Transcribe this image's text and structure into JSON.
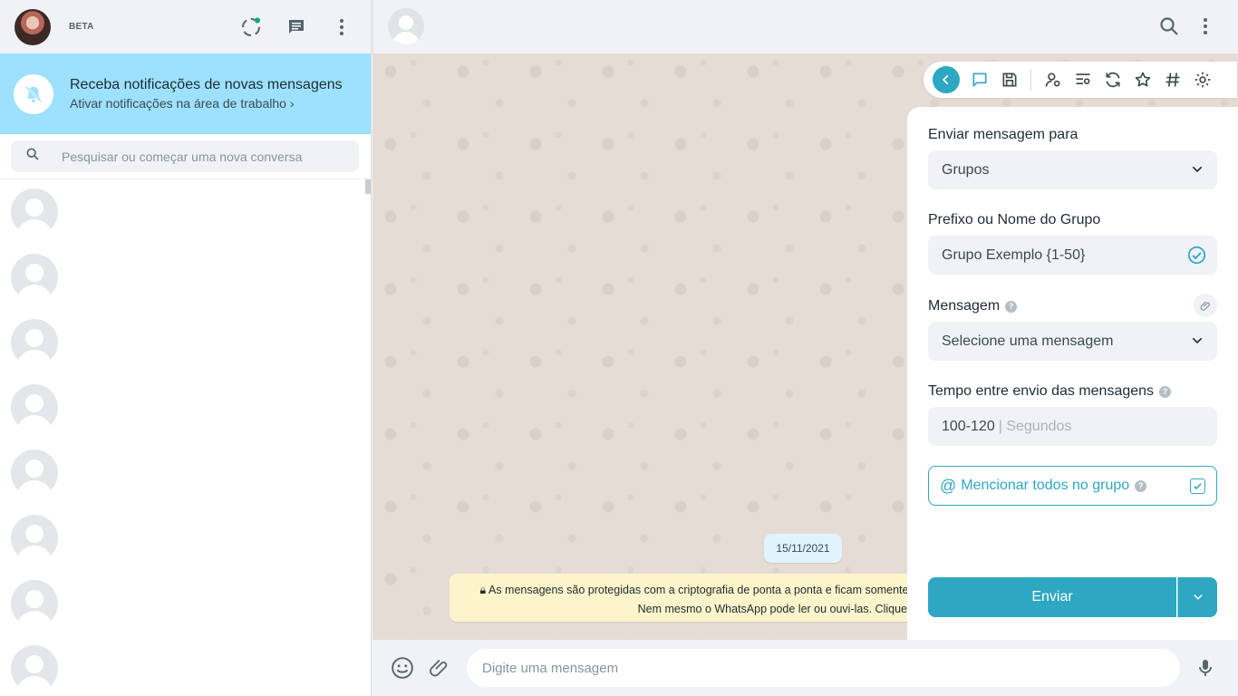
{
  "left_header": {
    "beta_label": "BETA"
  },
  "notification_banner": {
    "title": "Receba notificações de novas mensagens",
    "subtitle": "Ativar notificações na área de trabalho"
  },
  "search": {
    "placeholder": "Pesquisar ou começar uma nova conversa"
  },
  "chat_list": {
    "placeholder_rows": 8
  },
  "chat": {
    "date_chip": "15/11/2021",
    "encryption_line1": "As mensagens são protegidas com a criptografia de ponta a ponta e ficam somente",
    "encryption_line2": "Nem mesmo o WhatsApp pode ler ou ouvi-las. Clique pa"
  },
  "composer": {
    "placeholder": "Digite uma mensagem"
  },
  "panel": {
    "send_to_label": "Enviar mensagem para",
    "send_to_value": "Grupos",
    "group_label": "Prefixo ou Nome do Grupo",
    "group_value": "Grupo Exemplo {1-50}",
    "message_label": "Mensagem",
    "message_value": "Selecione uma mensagem",
    "interval_label": "Tempo entre envio das mensagens",
    "interval_value": "100-120",
    "interval_unit": "| Segundos",
    "mention_label": "Mencionar todos no grupo",
    "mention_checked": true,
    "send_label": "Enviar"
  },
  "colors": {
    "accent": "#2ea8c2",
    "notify_banner": "#9de1fe",
    "chat_bg": "#e5ddd5",
    "system_note": "#fcf4cb",
    "date_chip": "#e1f3fb",
    "status_dot": "#00a884"
  },
  "icons": {
    "left_header": [
      "status-icon",
      "new-chat-icon",
      "menu-icon"
    ],
    "main_header": [
      "search-icon",
      "menu-icon"
    ],
    "toolbar": [
      "back-icon",
      "chat-icon",
      "save-icon",
      "contact-settings-icon",
      "list-settings-icon",
      "refresh-icon",
      "star-icon",
      "hashtag-icon",
      "gear-icon"
    ],
    "composer": [
      "emoji-icon",
      "attach-icon",
      "mic-icon"
    ]
  }
}
